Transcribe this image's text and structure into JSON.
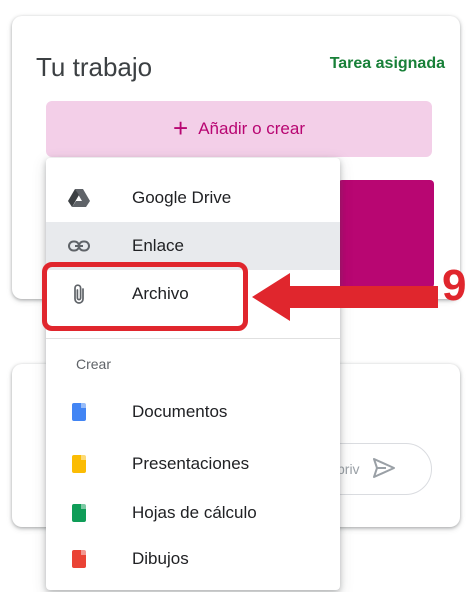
{
  "work_card": {
    "title": "Tu trabajo",
    "status": "Tarea asignada"
  },
  "add_button": {
    "icon": "plus-icon",
    "label": "Añadir o crear"
  },
  "menu": {
    "attach_items": [
      {
        "label": "Google Drive",
        "icon": "google-drive-icon"
      },
      {
        "label": "Enlace",
        "icon": "link-icon"
      },
      {
        "label": "Archivo",
        "icon": "paperclip-icon"
      }
    ],
    "create_section_label": "Crear",
    "create_items": [
      {
        "label": "Documentos",
        "icon": "google-docs-icon",
        "color": "#4285f4"
      },
      {
        "label": "Presentaciones",
        "icon": "google-slides-icon",
        "color": "#fbbc04"
      },
      {
        "label": "Hojas de cálculo",
        "icon": "google-sheets-icon",
        "color": "#0f9d58"
      },
      {
        "label": "Dibujos",
        "icon": "google-drawings-icon",
        "color": "#ea4335"
      }
    ]
  },
  "private_comment": {
    "placeholder_fragment": "priv"
  },
  "annotation": {
    "step_number": "9",
    "color": "#e0262d"
  },
  "colors": {
    "accent": "#b80672",
    "add_button_bg": "#f3cfe8",
    "status_green": "#188038"
  }
}
